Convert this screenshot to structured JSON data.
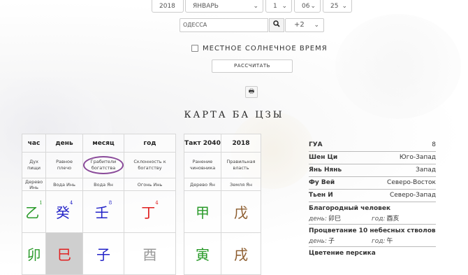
{
  "selectors": {
    "year": "2018",
    "month": "ЯНВАРЬ",
    "day": "1",
    "hour": "06",
    "minute": "25"
  },
  "city_input": "ОДЕССА",
  "timezone": "+2",
  "solar_time_label": "МЕСТНОЕ СОЛНЕЧНОЕ ВРЕМЯ",
  "calc_button": "РАССЧИТАТЬ",
  "print_icon": "🖶",
  "chart_title": "КАРТА БА ЦЗЫ",
  "pillars": {
    "headers": [
      "час",
      "день",
      "месяц",
      "год"
    ],
    "gods": [
      "Дух пищи",
      "Равное плечо",
      "Грабители богатства",
      "Склонность к богатству"
    ],
    "elements": [
      "Дерево Инь",
      "Вода Инь",
      "Вода Ян",
      "Огонь Инь"
    ],
    "stems": [
      {
        "char": "乙",
        "num": "1",
        "color": "#2a9a2a"
      },
      {
        "char": "癸",
        "num": "4",
        "color": "#2323c8"
      },
      {
        "char": "壬",
        "num": "8",
        "color": "#2323c8"
      },
      {
        "char": "丁",
        "num": "4",
        "color": "#e02020"
      }
    ],
    "branches": [
      {
        "char": "卯",
        "color": "#2a9a2a"
      },
      {
        "char": "巳",
        "color": "#e02020"
      },
      {
        "char": "子",
        "color": "#2323c8"
      },
      {
        "char": "酉",
        "color": "#999999"
      }
    ]
  },
  "luck": {
    "headers": [
      "Такт 2040",
      "2018"
    ],
    "gods": [
      "Ранение чиновника",
      "Правильная власть"
    ],
    "elements": [
      "Дерево Ян",
      "Земля Ян"
    ],
    "stems": [
      {
        "char": "甲",
        "color": "#2a9a2a"
      },
      {
        "char": "戊",
        "color": "#8b5a2b"
      }
    ],
    "branches": [
      {
        "char": "寅",
        "color": "#2a9a2a"
      },
      {
        "char": "戌",
        "color": "#8b5a2b"
      }
    ]
  },
  "info": {
    "gua_label": "ГУА",
    "gua_value": "8",
    "shen_label": "Шен Ци",
    "shen_value": "Юго-Запад",
    "yan_label": "Янь Нянь",
    "yan_value": "Запад",
    "fu_label": "Фу Вей",
    "fu_value": "Северо-Восток",
    "tyen_label": "Тьен И",
    "tyen_value": "Северо-Запад",
    "noble_title": "Благородный человек",
    "noble_day_label": "день:",
    "noble_day_value": "卯巳",
    "noble_year_label": "год:",
    "noble_year_value": "酉亥",
    "prosperity_title": "Процветание 10 небесных стволов",
    "pros_day_label": "день:",
    "pros_day_value": "子",
    "pros_year_label": "год:",
    "pros_year_value": "午",
    "peach_title": "Цветение персика"
  }
}
